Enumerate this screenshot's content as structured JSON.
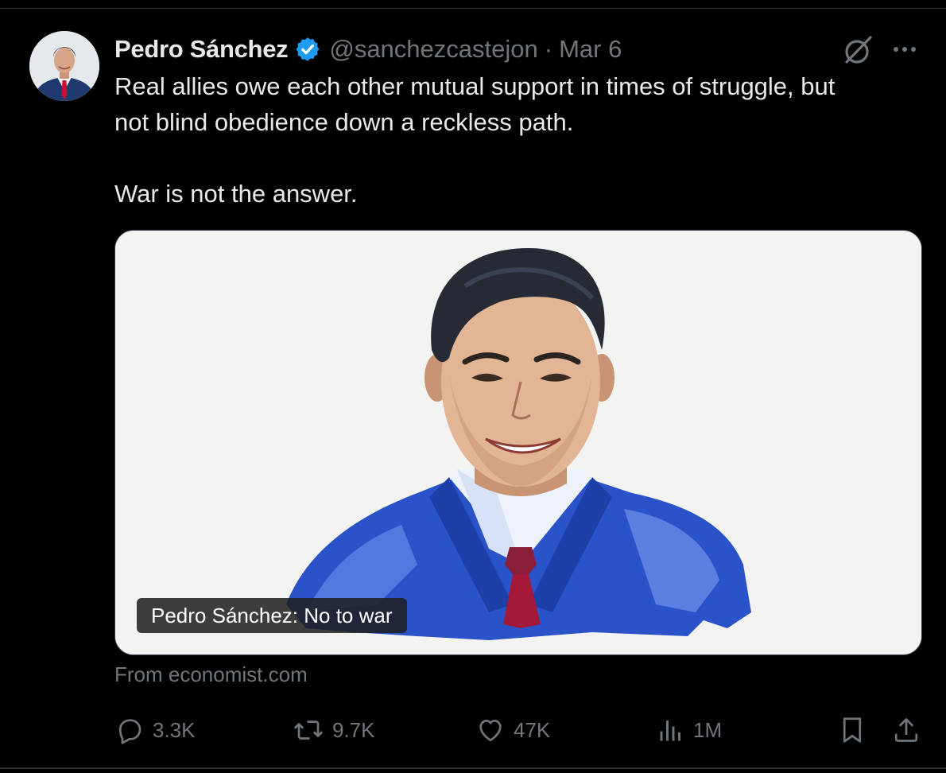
{
  "tweet": {
    "display_name": "Pedro Sánchez",
    "handle": "@sanchezcastejon",
    "separator": "·",
    "date": "Mar 6",
    "text": "Real allies owe each other mutual support in times of struggle, but\nnot blind obedience down a reckless path.\n\nWar is not the answer."
  },
  "card": {
    "caption": "Pedro Sánchez: No to war",
    "source": "From economist.com"
  },
  "actions": {
    "replies": "3.3K",
    "reposts": "9.7K",
    "likes": "47K",
    "views": "1M"
  },
  "icons": {
    "verified": "verified-badge-icon",
    "grok": "grok-icon",
    "more": "more-icon",
    "reply": "reply-icon",
    "repost": "repost-icon",
    "like": "heart-icon",
    "views": "views-icon",
    "bookmark": "bookmark-icon",
    "share": "share-icon"
  },
  "colors": {
    "background": "#000000",
    "text": "#e7e9ea",
    "muted": "#71767b",
    "verified": "#1d9bf0",
    "border": "#2f3336"
  }
}
